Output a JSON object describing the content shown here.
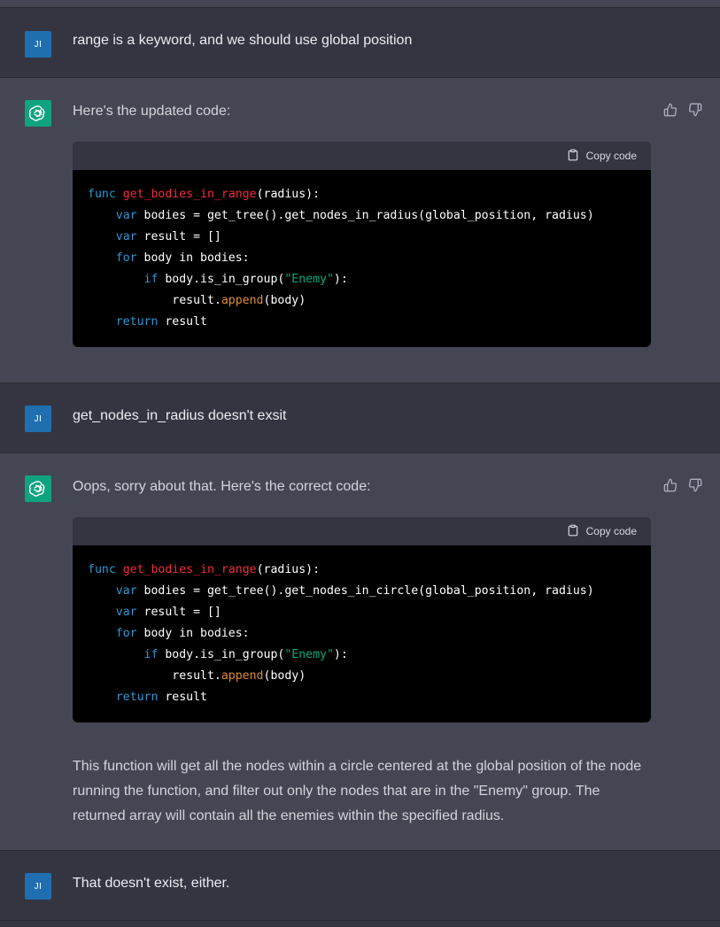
{
  "messages": {
    "user1": {
      "avatar": "JI",
      "text": "range is a keyword, and we should use global position"
    },
    "bot1": {
      "text": "Here's the updated code:",
      "copy_label": "Copy code",
      "code": {
        "l1": {
          "kw": "func",
          "fn": "get_bodies_in_range",
          "rest": "(radius):"
        },
        "l2": {
          "indent": "    ",
          "kw": "var",
          "rest": " bodies = get_tree().get_nodes_in_radius(global_position, radius)"
        },
        "l3": {
          "indent": "    ",
          "kw": "var",
          "rest": " result = []"
        },
        "l4": {
          "indent": "    ",
          "kw": "for",
          "rest": " body in bodies:"
        },
        "l5": {
          "indent": "        ",
          "kw": "if",
          "rest": " body.is_in_group(",
          "str": "\"Enemy\"",
          "end": "):"
        },
        "l6": {
          "indent": "            ",
          "pre": "result.",
          "mt": "append",
          "rest": "(body)"
        },
        "l7": {
          "indent": "    ",
          "kw": "return",
          "rest": " result"
        }
      }
    },
    "user2": {
      "avatar": "JI",
      "text": "get_nodes_in_radius doesn't exsit"
    },
    "bot2": {
      "text": "Oops, sorry about that. Here's the correct code:",
      "copy_label": "Copy code",
      "code": {
        "l1": {
          "kw": "func",
          "fn": "get_bodies_in_range",
          "rest": "(radius):"
        },
        "l2": {
          "indent": "    ",
          "kw": "var",
          "rest": " bodies = get_tree().get_nodes_in_circle(global_position, radius)"
        },
        "l3": {
          "indent": "    ",
          "kw": "var",
          "rest": " result = []"
        },
        "l4": {
          "indent": "    ",
          "kw": "for",
          "rest": " body in bodies:"
        },
        "l5": {
          "indent": "        ",
          "kw": "if",
          "rest": " body.is_in_group(",
          "str": "\"Enemy\"",
          "end": "):"
        },
        "l6": {
          "indent": "            ",
          "pre": "result.",
          "mt": "append",
          "rest": "(body)"
        },
        "l7": {
          "indent": "    ",
          "kw": "return",
          "rest": " result"
        }
      },
      "explanation": "This function will get all the nodes within a circle centered at the global position of the node running the function, and filter out only the nodes that are in the \"Enemy\" group. The returned array will contain all the enemies within the specified radius."
    },
    "user3": {
      "avatar": "JI",
      "text": "That doesn't exist, either."
    }
  },
  "icons": {
    "thumbs_up": "thumbs-up-icon",
    "thumbs_down": "thumbs-down-icon",
    "clipboard": "clipboard-icon",
    "openai_logo": "openai-logo-icon"
  },
  "colors": {
    "user_bg": "#343541",
    "assistant_bg": "#444654",
    "user_avatar": "#1f6fb0",
    "bot_avatar": "#10a37f",
    "keyword": "#2e95d3",
    "function_name": "#f22c3d",
    "string": "#00a67d",
    "method": "#df8b3a"
  }
}
